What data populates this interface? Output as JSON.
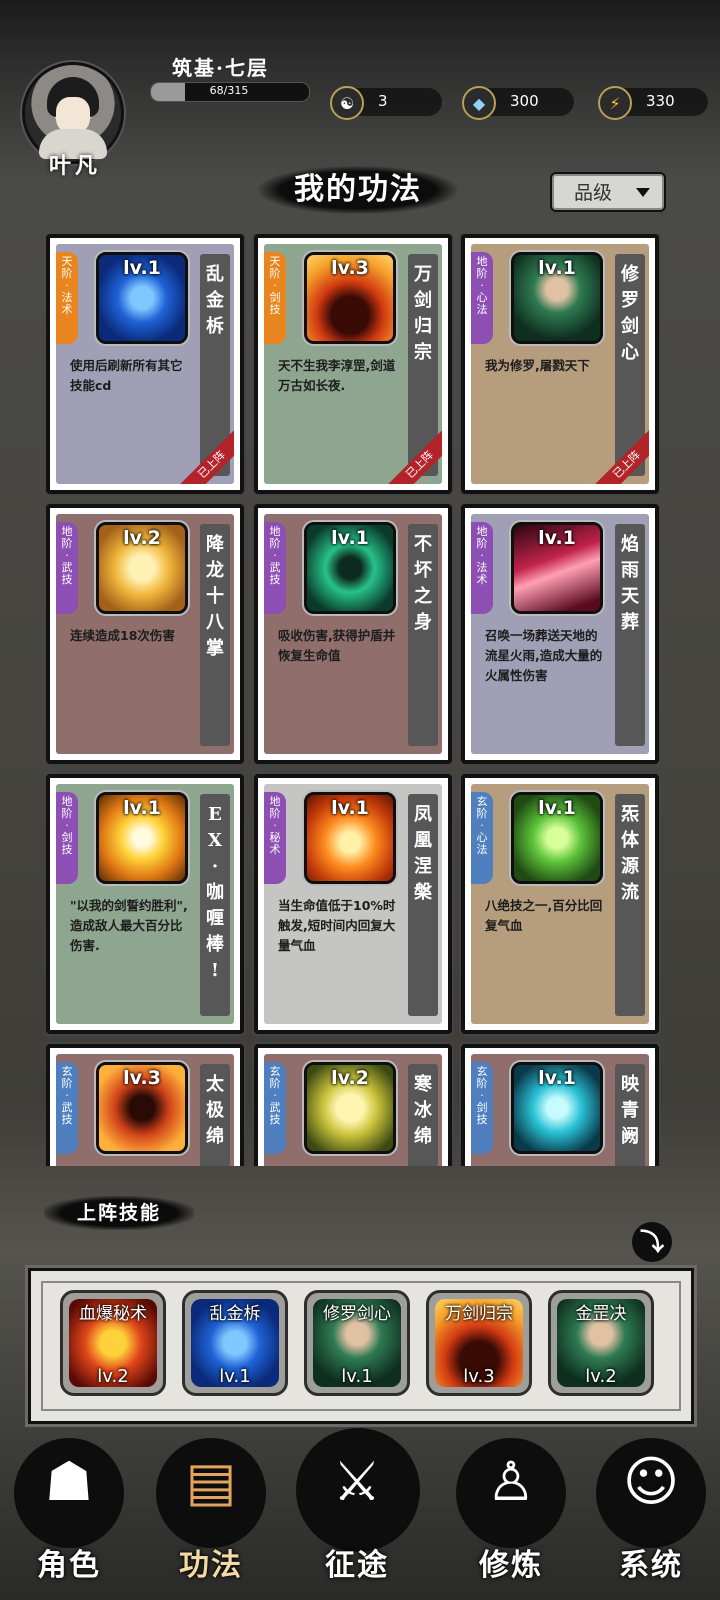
{
  "player": {
    "name": "叶凡",
    "realm": "筑基·七层",
    "exp_current": 68,
    "exp_max": 315,
    "exp_text": "68/315"
  },
  "resources": [
    {
      "icon": "yin-yang-icon",
      "value": "3"
    },
    {
      "icon": "spirit-stone-icon",
      "value": "300"
    },
    {
      "icon": "lightning-energy-icon",
      "value": "330"
    }
  ],
  "section_title": "我的功法",
  "grade_filter": {
    "label": "品级"
  },
  "colors": {
    "tian_tier": "#e8851e",
    "di_tier": "#8d4fb4",
    "xuan_tier": "#4f7fbf",
    "equipped_ribbon": "#b3232a"
  },
  "skills": [
    {
      "tier": "天阶·法术",
      "tier_color": "#e8851e",
      "level": "lv.1",
      "name": "乱金柝",
      "desc": "使用后刷新所有其它技能cd",
      "equipped_label": "已上阵",
      "bg": "#a19fb6",
      "icon": "hexagram-icon"
    },
    {
      "tier": "天阶·剑技",
      "tier_color": "#e8851e",
      "level": "lv.3",
      "name": "万剑归宗",
      "desc": "天不生我李淳罡,剑道万古如长夜.",
      "equipped_label": "已上阵",
      "bg": "#8ea58f",
      "icon": "flame-figure-icon"
    },
    {
      "tier": "地阶·心法",
      "tier_color": "#8d4fb4",
      "level": "lv.1",
      "name": "修罗剑心",
      "desc": "我为修罗,屠戮天下",
      "equipped_label": "已上阵",
      "bg": "#b69d7e",
      "icon": "hooded-warrior-icon"
    },
    {
      "tier": "地阶·武技",
      "tier_color": "#8d4fb4",
      "level": "lv.2",
      "name": "降龙十八掌",
      "desc": "连续造成18次伤害",
      "bg": "#8f6e6c",
      "icon": "golden-palm-icon"
    },
    {
      "tier": "地阶·武技",
      "tier_color": "#8d4fb4",
      "level": "lv.1",
      "name": "不坏之身",
      "desc": "吸收伤害,获得护盾并恢复生命值",
      "bg": "#8f6e6c",
      "icon": "green-aura-icon"
    },
    {
      "tier": "地阶·法术",
      "tier_color": "#8d4fb4",
      "level": "lv.1",
      "name": "焰雨天葬",
      "desc": "召唤一场葬送天地的流星火雨,造成大量的火属性伤害",
      "bg": "#a19fb6",
      "icon": "meteor-rain-icon"
    },
    {
      "tier": "地阶·剑技",
      "tier_color": "#8d4fb4",
      "level": "lv.1",
      "name": "EX·咖喱棒!",
      "desc": "\"以我的剑誓约胜利\",造成敌人最大百分比伤害.",
      "bg": "#8ea58f",
      "icon": "light-cross-icon"
    },
    {
      "tier": "地阶·秘术",
      "tier_color": "#8d4fb4",
      "level": "lv.1",
      "name": "凤凰涅槃",
      "desc": "当生命值低于10%时触发,短时间内回复大量气血",
      "bg": "#c5c5c3",
      "icon": "phoenix-icon"
    },
    {
      "tier": "玄阶·心法",
      "tier_color": "#4f7fbf",
      "level": "lv.1",
      "name": "炁体源流",
      "desc": "八绝技之一,百分比回复气血",
      "bg": "#b69d7e",
      "icon": "green-qi-icon"
    },
    {
      "tier": "玄阶·武技",
      "tier_color": "#4f7fbf",
      "level": "lv.3",
      "name": "太极绵",
      "desc": "",
      "bg": "#8f6e6c",
      "icon": "fire-hand-icon"
    },
    {
      "tier": "玄阶·武技",
      "tier_color": "#4f7fbf",
      "level": "lv.2",
      "name": "寒冰绵",
      "desc": "",
      "bg": "#8f6e6c",
      "icon": "golden-fist-icon"
    },
    {
      "tier": "玄阶·剑技",
      "tier_color": "#4f7fbf",
      "level": "lv.1",
      "name": "映青阙",
      "desc": "",
      "bg": "#8f6e6c",
      "icon": "blue-wind-icon"
    }
  ],
  "loadout": {
    "title": "上阵技能",
    "slots": [
      {
        "name": "血爆秘术",
        "level": "lv.2",
        "icon": "blood-burst-icon"
      },
      {
        "name": "乱金柝",
        "level": "lv.1",
        "icon": "hexagram-icon"
      },
      {
        "name": "修罗剑心",
        "level": "lv.1",
        "icon": "hooded-warrior-icon"
      },
      {
        "name": "万剑归宗",
        "level": "lv.3",
        "icon": "flame-figure-icon"
      },
      {
        "name": "金罡决",
        "level": "lv.2",
        "icon": "hooded-warrior-icon"
      }
    ]
  },
  "nav": [
    {
      "label": "角色",
      "icon": "hooded-figure-icon"
    },
    {
      "label": "功法",
      "icon": "scroll-books-icon"
    },
    {
      "label": "征途",
      "icon": "sword-emblem-icon"
    },
    {
      "label": "修炼",
      "icon": "meditating-figure-icon"
    },
    {
      "label": "系统",
      "icon": "mascot-face-icon"
    }
  ]
}
